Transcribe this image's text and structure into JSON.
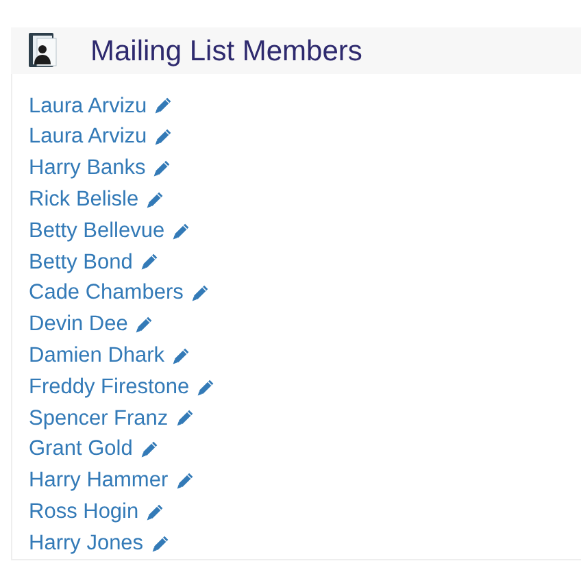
{
  "header": {
    "title": "Mailing List Members"
  },
  "members": [
    {
      "name": "Laura Arvizu"
    },
    {
      "name": "Laura Arvizu"
    },
    {
      "name": "Harry Banks"
    },
    {
      "name": "Rick Belisle"
    },
    {
      "name": "Betty Bellevue"
    },
    {
      "name": "Betty Bond"
    },
    {
      "name": "Cade Chambers"
    },
    {
      "name": "Devin Dee"
    },
    {
      "name": "Damien Dhark"
    },
    {
      "name": "Freddy Firestone"
    },
    {
      "name": "Spencer Franz"
    },
    {
      "name": "Grant Gold"
    },
    {
      "name": "Harry Hammer"
    },
    {
      "name": "Ross Hogin"
    },
    {
      "name": "Harry Jones"
    }
  ]
}
